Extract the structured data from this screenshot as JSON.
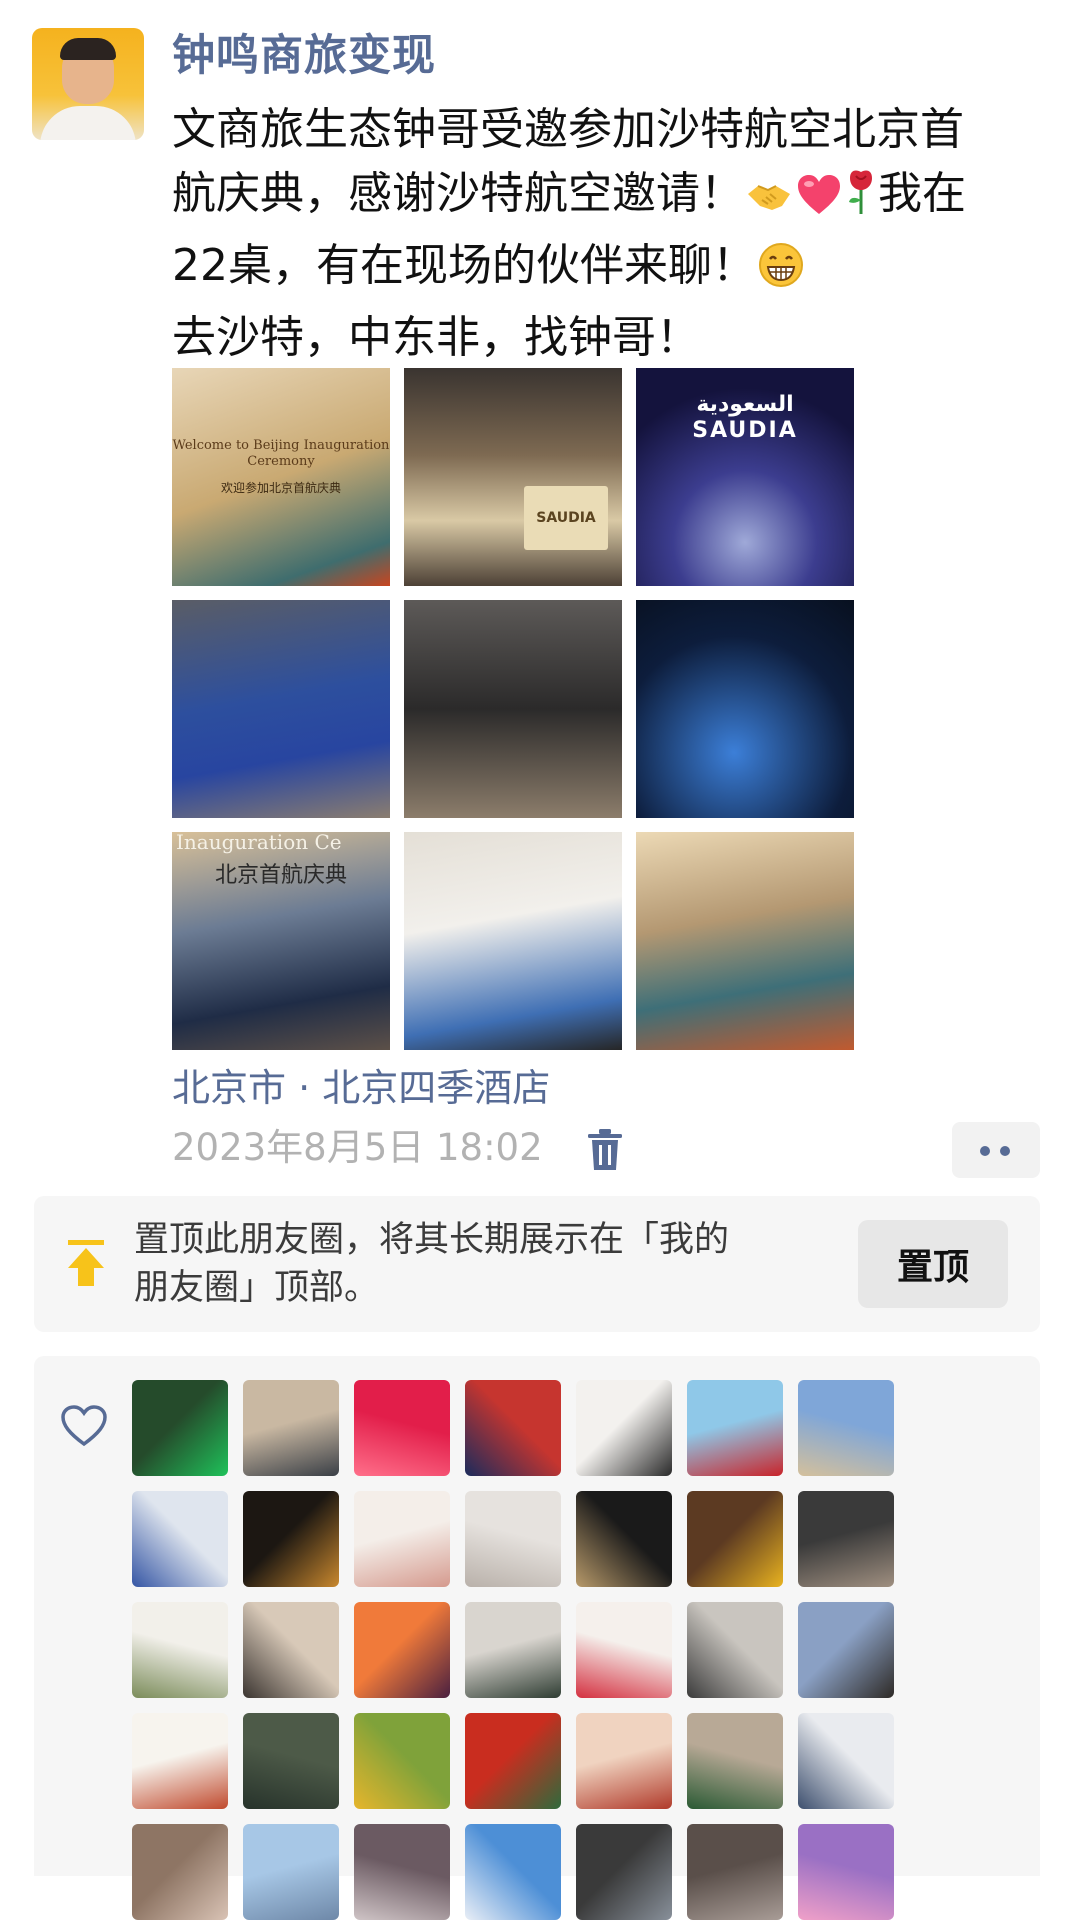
{
  "post": {
    "author": "钟鸣商旅变现",
    "text_lines": [
      "文商旅生态钟哥受邀参加沙特航空北京首",
      "航庆典，感谢沙特航空邀请！",
      "我在",
      "22桌，有在现场的伙伴来聊！",
      "去沙特，中东非，找钟哥！"
    ],
    "emojis": [
      "handshake-emoji",
      "heart-emoji",
      "rose-emoji",
      "grin-emoji"
    ],
    "photos": [
      {
        "name": "photo-welcome-board",
        "caption_en": "Welcome to Beijing Inauguration Ceremony",
        "caption_cn": "欢迎参加北京首航庆典"
      },
      {
        "name": "photo-venue-entrance",
        "sign": "SAUDIA"
      },
      {
        "name": "photo-light-tunnel",
        "logo_ar": "السعودية",
        "logo_en": "SAUDIA"
      },
      {
        "name": "photo-flight-attendants"
      },
      {
        "name": "photo-coffee-pourers"
      },
      {
        "name": "photo-night-city-selfie"
      },
      {
        "name": "photo-fan-gift",
        "caption_en": "Inauguration Ce",
        "caption_cn": "北京首航庆典"
      },
      {
        "name": "photo-selfie-with-guest"
      },
      {
        "name": "photo-stage-photo"
      }
    ],
    "location": "北京市 · 北京四季酒店",
    "timestamp": "2023年8月5日 18:02"
  },
  "pin_prompt": {
    "text": "置顶此朋友圈，将其长期展示在「我的朋友圈」顶部。",
    "button_label": "置顶"
  },
  "likes": {
    "icon": "heart-outline-icon",
    "avatars": [
      {
        "c1": "#254b2b",
        "c2": "#1fc25a"
      },
      {
        "c1": "#c9b8a2",
        "c2": "#3a3f46"
      },
      {
        "c1": "#e21e4a",
        "c2": "#ff6f8a"
      },
      {
        "c1": "#c6352f",
        "c2": "#1b2b5c"
      },
      {
        "c1": "#f3f1ee",
        "c2": "#2a2a2a"
      },
      {
        "c1": "#8fc8e8",
        "c2": "#c8242a"
      },
      {
        "c1": "#7fa6d8",
        "c2": "#d4c09c"
      },
      {
        "c1": "#dfe5ee",
        "c2": "#3455a4"
      },
      {
        "c1": "#1c1712",
        "c2": "#c9882e"
      },
      {
        "c1": "#f4eee9",
        "c2": "#d59a8e"
      },
      {
        "c1": "#e6e2de",
        "c2": "#b9b1aa"
      },
      {
        "c1": "#1a1a1a",
        "c2": "#b89a6a"
      },
      {
        "c1": "#5c3a22",
        "c2": "#e9b320"
      },
      {
        "c1": "#3a3a3a",
        "c2": "#9f8f80"
      },
      {
        "c1": "#f2f0ea",
        "c2": "#7b8c5a"
      },
      {
        "c1": "#d8c9b8",
        "c2": "#3a3430"
      },
      {
        "c1": "#f07a3a",
        "c2": "#4a2040"
      },
      {
        "c1": "#d9d5cf",
        "c2": "#2f3d33"
      },
      {
        "c1": "#f5f0ec",
        "c2": "#d43040"
      },
      {
        "c1": "#c9c5bf",
        "c2": "#3b3b3b"
      },
      {
        "c1": "#8aa0c4",
        "c2": "#2e2a26"
      },
      {
        "c1": "#f7f4ee",
        "c2": "#c04a2e"
      },
      {
        "c1": "#4d5a48",
        "c2": "#27332b"
      },
      {
        "c1": "#7fa23a",
        "c2": "#e7b52c"
      },
      {
        "c1": "#c92d1f",
        "c2": "#2f6a3c"
      },
      {
        "c1": "#f0d3c0",
        "c2": "#b03a2a"
      },
      {
        "c1": "#b8a996",
        "c2": "#2a5a34"
      },
      {
        "c1": "#e9ebef",
        "c2": "#3d4f6e"
      },
      {
        "c1": "#8e7564",
        "c2": "#d9c3b5"
      },
      {
        "c1": "#a7c7e6",
        "c2": "#6e88a8"
      },
      {
        "c1": "#6b5a62",
        "c2": "#cfc4c6"
      },
      {
        "c1": "#4d8fd6",
        "c2": "#e9eef6"
      },
      {
        "c1": "#3a3a3a",
        "c2": "#88909a"
      },
      {
        "c1": "#5a4f4a",
        "c2": "#a89c96"
      },
      {
        "c1": "#9a70c4",
        "c2": "#f0a0c8"
      }
    ]
  },
  "colors": {
    "link_blue": "#576b95",
    "pin_yellow": "#f7c31a",
    "gray_text": "#b2b2b2",
    "card_bg": "#f6f6f6"
  }
}
